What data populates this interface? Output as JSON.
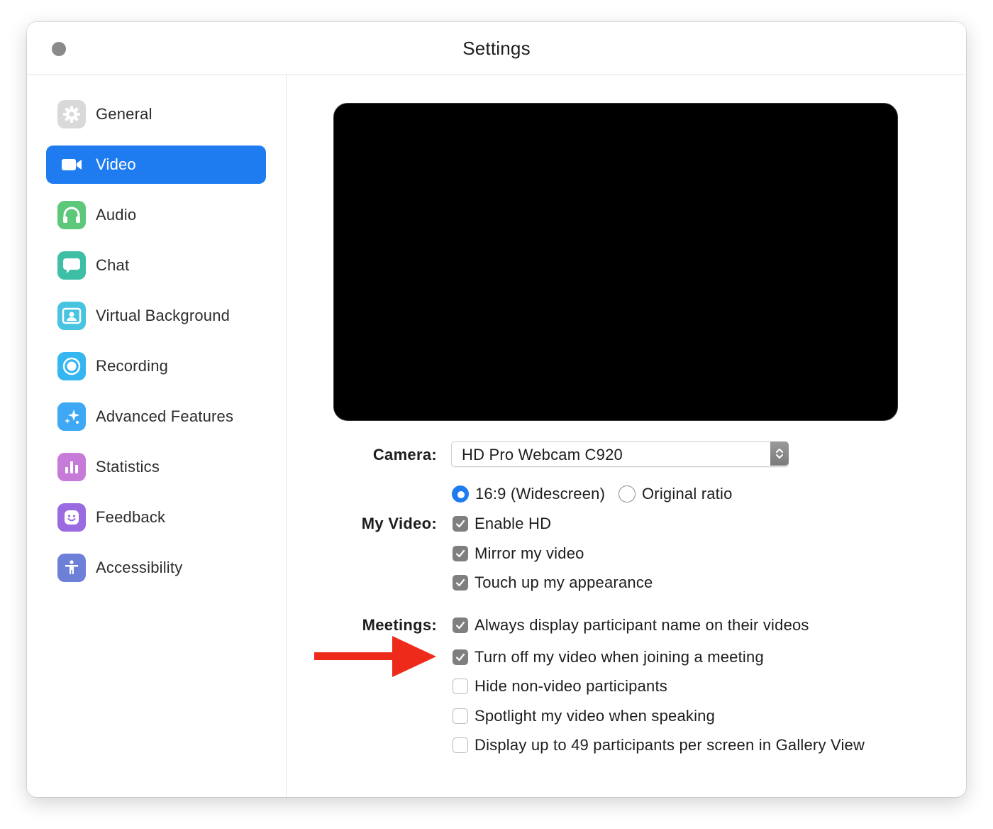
{
  "window": {
    "title": "Settings"
  },
  "sidebar": {
    "items": [
      {
        "label": "General",
        "icon": "gear-icon",
        "color": "#d9d9d9",
        "active": false
      },
      {
        "label": "Video",
        "icon": "video-camera-icon",
        "color": "#1f7cf0",
        "active": true
      },
      {
        "label": "Audio",
        "icon": "headphones-icon",
        "color": "#5dc77a",
        "active": false
      },
      {
        "label": "Chat",
        "icon": "chat-bubble-icon",
        "color": "#3dbfa5",
        "active": false
      },
      {
        "label": "Virtual Background",
        "icon": "person-portrait-icon",
        "color": "#48c3e0",
        "active": false
      },
      {
        "label": "Recording",
        "icon": "record-icon",
        "color": "#35b6f0",
        "active": false
      },
      {
        "label": "Advanced Features",
        "icon": "sparkles-icon",
        "color": "#3ea8f4",
        "active": false
      },
      {
        "label": "Statistics",
        "icon": "bar-chart-icon",
        "color": "#c77bd8",
        "active": false
      },
      {
        "label": "Feedback",
        "icon": "smiley-icon",
        "color": "#9a6be0",
        "active": false
      },
      {
        "label": "Accessibility",
        "icon": "accessibility-person-icon",
        "color": "#6e7fd8",
        "active": false
      }
    ]
  },
  "camera": {
    "label": "Camera:",
    "selected": "HD Pro Webcam C920"
  },
  "my_video": {
    "label": "My Video:",
    "ratio_options": [
      {
        "label": "16:9 (Widescreen)",
        "selected": true
      },
      {
        "label": "Original ratio",
        "selected": false
      }
    ],
    "checkboxes": [
      {
        "label": "Enable HD",
        "checked": true
      },
      {
        "label": "Mirror my video",
        "checked": true
      },
      {
        "label": "Touch up my appearance",
        "checked": true
      }
    ]
  },
  "meetings": {
    "label": "Meetings:",
    "checkboxes": [
      {
        "label": "Always display participant name on their videos",
        "checked": true
      },
      {
        "label": "Turn off my video when joining a meeting",
        "checked": true
      },
      {
        "label": "Hide non-video participants",
        "checked": false
      },
      {
        "label": "Spotlight my video when speaking",
        "checked": false
      },
      {
        "label": "Display up to 49 participants per screen in Gallery View",
        "checked": false
      }
    ]
  },
  "annotation": {
    "arrow_color": "#ee2b1a"
  }
}
